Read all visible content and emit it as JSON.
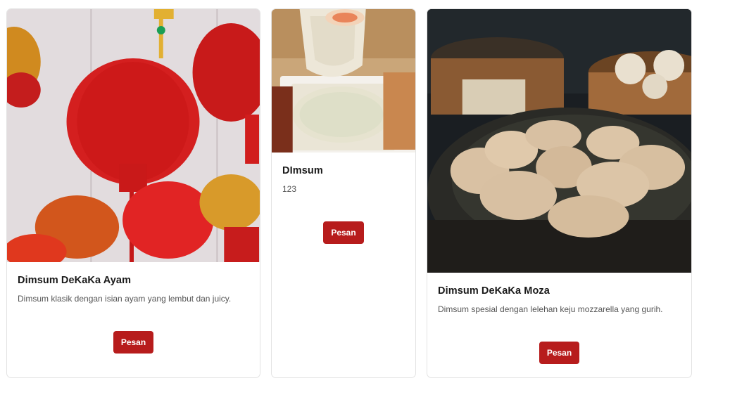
{
  "products": [
    {
      "image": "red-lanterns-photo",
      "title": "Dimsum DeKaKa Ayam",
      "description": "Dimsum klasik dengan isian ayam yang lembut dan juicy.",
      "button_label": "Pesan"
    },
    {
      "image": "dimsum-with-sauce-photo",
      "title": "DImsum",
      "description": "123",
      "button_label": "Pesan"
    },
    {
      "image": "dumplings-in-steamer-photo",
      "title": "Dimsum DeKaKa Moza",
      "description": "Dimsum spesial dengan lelehan keju mozzarella yang gurih.",
      "button_label": "Pesan"
    }
  ],
  "colors": {
    "button": "#b71c1c",
    "card_border": "#e3e3e3"
  }
}
